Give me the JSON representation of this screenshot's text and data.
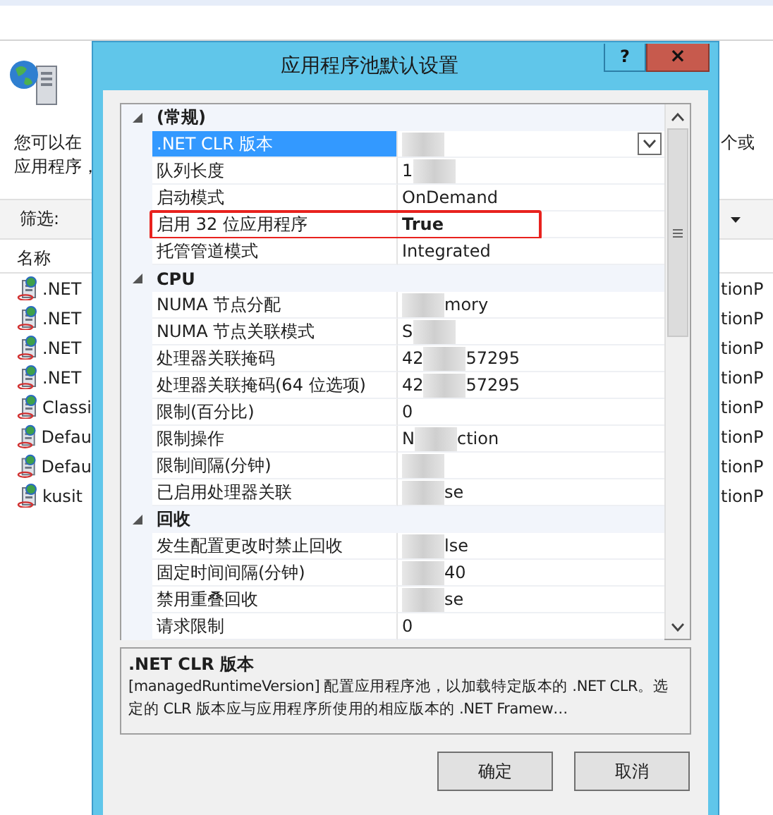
{
  "background_window": {
    "intro_lines": [
      "您可以在",
      "应用程序，"
    ],
    "right_intro": "个或",
    "filter_label": "筛选:",
    "list_header": "名称",
    "pools": [
      {
        "name": ".NET",
        "right_text": "tionP"
      },
      {
        "name": ".NET",
        "right_text": "tionP"
      },
      {
        "name": ".NET",
        "right_text": "tionP"
      },
      {
        "name": ".NET",
        "right_text": "tionP"
      },
      {
        "name": "Classi",
        "right_text": "tionP"
      },
      {
        "name": "Defau",
        "right_text": "tionP"
      },
      {
        "name": "Defau",
        "right_text": "tionP"
      },
      {
        "name": "kusit",
        "right_text": "tionP"
      }
    ]
  },
  "dialog": {
    "title": "应用程序池默认设置",
    "help_button": "?",
    "close_button": "×",
    "categories": [
      {
        "name": "(常规)",
        "expanded": true,
        "properties": [
          {
            "name": ".NET CLR 版本",
            "selected": true,
            "highlighted": false,
            "value_parts": [
              {
                "kind": "blur"
              }
            ]
          },
          {
            "name": "队列长度",
            "selected": false,
            "modified": false,
            "highlighted": false,
            "value_parts": [
              {
                "kind": "text",
                "text": "1"
              },
              {
                "kind": "blur"
              }
            ]
          },
          {
            "name": "启动模式",
            "selected": false,
            "modified": false,
            "highlighted": false,
            "value_parts": [
              {
                "kind": "text",
                "text": "OnDemand"
              }
            ]
          },
          {
            "name": "启用 32 位应用程序",
            "selected": false,
            "modified": true,
            "highlighted": true,
            "value_parts": [
              {
                "kind": "text",
                "text": "True"
              }
            ]
          },
          {
            "name": "托管管道模式",
            "selected": false,
            "modified": false,
            "highlighted": false,
            "value_parts": [
              {
                "kind": "text",
                "text": "Integrated"
              }
            ]
          }
        ]
      },
      {
        "name": "CPU",
        "expanded": true,
        "properties": [
          {
            "name": "NUMA 节点分配",
            "selected": false,
            "modified": false,
            "highlighted": false,
            "value_parts": [
              {
                "kind": "blur"
              },
              {
                "kind": "text",
                "text": "mory"
              }
            ]
          },
          {
            "name": "NUMA 节点关联模式",
            "selected": false,
            "modified": false,
            "highlighted": false,
            "value_parts": [
              {
                "kind": "text",
                "text": "S"
              },
              {
                "kind": "blur"
              }
            ]
          },
          {
            "name": "处理器关联掩码",
            "selected": false,
            "modified": false,
            "highlighted": false,
            "value_parts": [
              {
                "kind": "text",
                "text": "42"
              },
              {
                "kind": "blur"
              },
              {
                "kind": "text",
                "text": "57295"
              }
            ]
          },
          {
            "name": "处理器关联掩码(64 位选项)",
            "selected": false,
            "modified": false,
            "highlighted": false,
            "value_parts": [
              {
                "kind": "text",
                "text": "42"
              },
              {
                "kind": "blur"
              },
              {
                "kind": "text",
                "text": "57295"
              }
            ]
          },
          {
            "name": "限制(百分比)",
            "selected": false,
            "modified": false,
            "highlighted": false,
            "value_parts": [
              {
                "kind": "text",
                "text": "0"
              }
            ]
          },
          {
            "name": "限制操作",
            "selected": false,
            "modified": false,
            "highlighted": false,
            "value_parts": [
              {
                "kind": "text",
                "text": "N"
              },
              {
                "kind": "blur"
              },
              {
                "kind": "text",
                "text": "ction"
              }
            ]
          },
          {
            "name": "限制间隔(分钟)",
            "selected": false,
            "highlighted": false,
            "value_parts": [
              {
                "kind": "blur"
              }
            ]
          },
          {
            "name": "已启用处理器关联",
            "selected": false,
            "modified": false,
            "highlighted": false,
            "value_parts": [
              {
                "kind": "blur"
              },
              {
                "kind": "text",
                "text": "se"
              }
            ]
          }
        ]
      },
      {
        "name": "回收",
        "expanded": true,
        "properties": [
          {
            "name": "发生配置更改时禁止回收",
            "selected": false,
            "modified": false,
            "highlighted": false,
            "value_parts": [
              {
                "kind": "blur"
              },
              {
                "kind": "text",
                "text": "lse"
              }
            ]
          },
          {
            "name": "固定时间间隔(分钟)",
            "selected": false,
            "modified": false,
            "highlighted": false,
            "value_parts": [
              {
                "kind": "blur"
              },
              {
                "kind": "text",
                "text": "40"
              }
            ]
          },
          {
            "name": "禁用重叠回收",
            "selected": false,
            "modified": false,
            "highlighted": false,
            "value_parts": [
              {
                "kind": "blur"
              },
              {
                "kind": "text",
                "text": "se"
              }
            ]
          },
          {
            "name": "请求限制",
            "selected": false,
            "modified": false,
            "highlighted": false,
            "value_parts": [
              {
                "kind": "text",
                "text": "0"
              }
            ]
          }
        ]
      }
    ],
    "description": {
      "title": ".NET CLR 版本",
      "text": " [managedRuntimeVersion] 配置应用程序池，以加载特定版本的 .NET CLR。选定的 CLR 版本应与应用程序所使用的相应版本的 .NET Framew…"
    },
    "buttons": [
      "确定",
      "取消"
    ]
  }
}
